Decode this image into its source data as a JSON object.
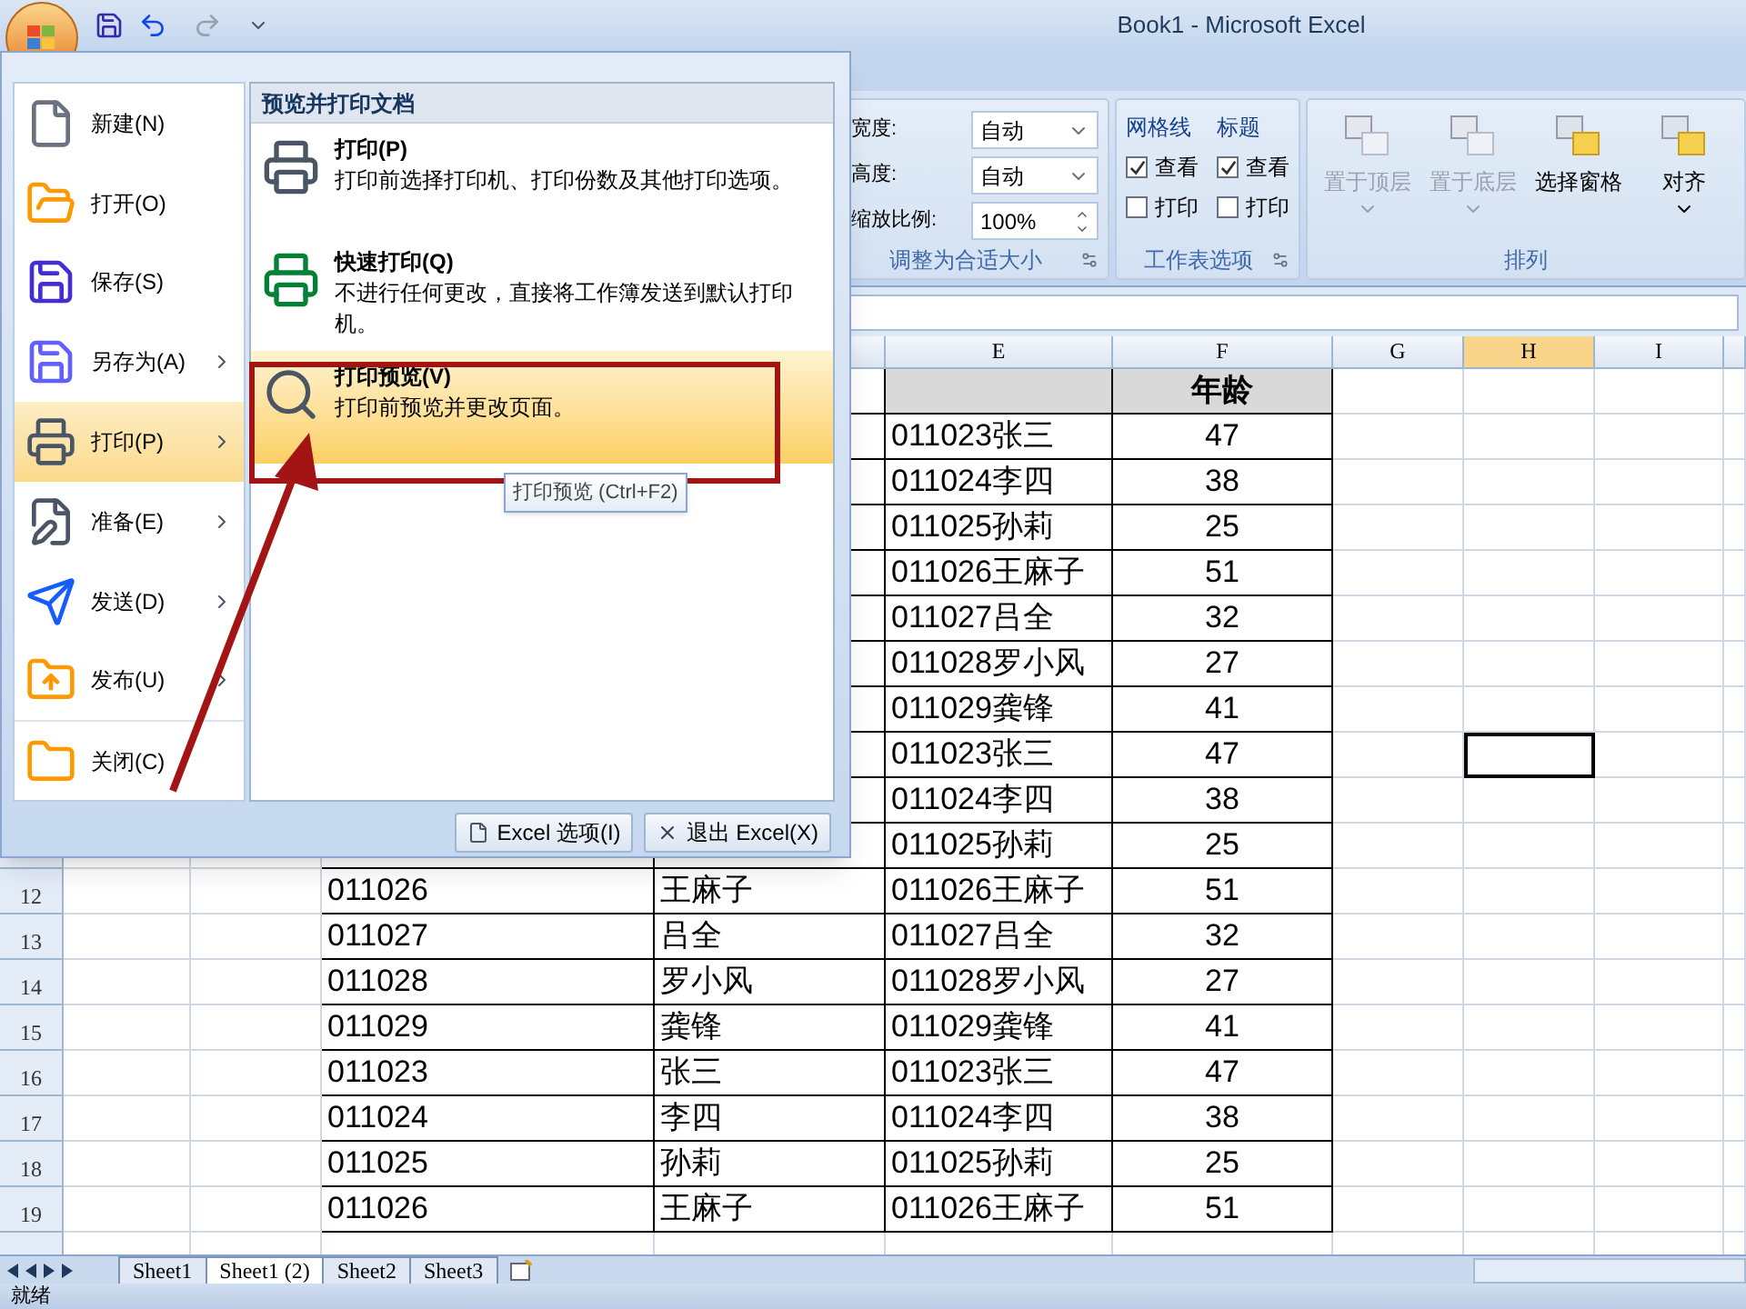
{
  "window": {
    "title": "Book1 - Microsoft Excel"
  },
  "ribbon": {
    "groups": [
      {
        "kind": "scale",
        "label": "调整为合适大小",
        "fields": [
          {
            "kind": "dropdown",
            "label": "宽度:",
            "value": "自动"
          },
          {
            "kind": "dropdown",
            "label": "高度:",
            "value": "自动"
          },
          {
            "kind": "spinner",
            "label": "缩放比例:",
            "value": "100%"
          }
        ]
      },
      {
        "kind": "sheet_options",
        "label": "工作表选项",
        "columns": [
          {
            "title": "网格线",
            "options": [
              {
                "label": "查看",
                "checked": true
              },
              {
                "label": "打印",
                "checked": false
              }
            ]
          },
          {
            "title": "标题",
            "options": [
              {
                "label": "查看",
                "checked": true
              },
              {
                "label": "打印",
                "checked": false
              }
            ]
          }
        ]
      },
      {
        "kind": "arrange",
        "label": "排列",
        "buttons": [
          {
            "label": "置于顶层",
            "disabled": true,
            "has_dropdown": true
          },
          {
            "label": "置于底层",
            "disabled": true,
            "has_dropdown": true
          },
          {
            "label": "选择窗格",
            "disabled": false,
            "has_dropdown": false
          },
          {
            "label": "对齐",
            "disabled": false,
            "has_dropdown": true
          }
        ]
      }
    ]
  },
  "sheet": {
    "columns": [
      {
        "label": "E",
        "selected": false
      },
      {
        "label": "F",
        "selected": false
      },
      {
        "label": "G",
        "selected": false
      },
      {
        "label": "H",
        "selected": true
      },
      {
        "label": "I",
        "selected": false
      }
    ],
    "rows": [
      {
        "kind": "header",
        "selected": false,
        "f": "年龄"
      },
      {
        "kind": "data",
        "selected": false,
        "e": "011023张三",
        "f": "47"
      },
      {
        "kind": "data",
        "selected": false,
        "e": "011024李四",
        "f": "38"
      },
      {
        "kind": "data",
        "selected": false,
        "e": "011025孙莉",
        "f": "25"
      },
      {
        "kind": "data",
        "selected": false,
        "e": "011026王麻子",
        "f": "51"
      },
      {
        "kind": "data",
        "selected": false,
        "e": "011027吕全",
        "f": "32"
      },
      {
        "kind": "data",
        "selected": false,
        "e": "011028罗小风",
        "f": "27"
      },
      {
        "kind": "data",
        "selected": false,
        "e": "011029龚锋",
        "f": "41"
      },
      {
        "kind": "data",
        "selected": true,
        "e": "011023张三",
        "f": "47"
      },
      {
        "kind": "data",
        "selected": false,
        "e": "011024李四",
        "f": "38"
      },
      {
        "kind": "data",
        "selected": false,
        "e": "011025孙莉",
        "f": "25"
      },
      {
        "kind": "data",
        "selected": false,
        "number": "12",
        "c": "011026",
        "d": "王麻子",
        "e": "011026王麻子",
        "f": "51"
      },
      {
        "kind": "data",
        "selected": false,
        "number": "13",
        "c": "011027",
        "d": "吕全",
        "e": "011027吕全",
        "f": "32"
      },
      {
        "kind": "data",
        "selected": false,
        "number": "14",
        "c": "011028",
        "d": "罗小风",
        "e": "011028罗小风",
        "f": "27"
      },
      {
        "kind": "data",
        "selected": false,
        "number": "15",
        "c": "011029",
        "d": "龚锋",
        "e": "011029龚锋",
        "f": "41"
      },
      {
        "kind": "data",
        "selected": false,
        "number": "16",
        "c": "011023",
        "d": "张三",
        "e": "011023张三",
        "f": "47"
      },
      {
        "kind": "data",
        "selected": false,
        "number": "17",
        "c": "011024",
        "d": "李四",
        "e": "011024李四",
        "f": "38"
      },
      {
        "kind": "data",
        "selected": false,
        "number": "18",
        "c": "011025",
        "d": "孙莉",
        "e": "011025孙莉",
        "f": "25"
      },
      {
        "kind": "data",
        "selected": false,
        "number": "19",
        "c": "011026",
        "d": "王麻子",
        "e": "011026王麻子",
        "f": "51"
      }
    ]
  },
  "sheet_tabs": [
    {
      "label": "Sheet1",
      "selected": false
    },
    {
      "label": "Sheet1 (2)",
      "selected": true
    },
    {
      "label": "Sheet2",
      "selected": false
    },
    {
      "label": "Sheet3",
      "selected": false
    }
  ],
  "status_bar": {
    "text": "就绪"
  },
  "office_menu": {
    "items": [
      {
        "label": "新建(N)",
        "has_submenu": false,
        "selected": false
      },
      {
        "label": "打开(O)",
        "has_submenu": false,
        "selected": false
      },
      {
        "label": "保存(S)",
        "has_submenu": false,
        "selected": false
      },
      {
        "label": "另存为(A)",
        "has_submenu": true,
        "selected": false
      },
      {
        "label": "打印(P)",
        "has_submenu": true,
        "selected": true
      },
      {
        "label": "准备(E)",
        "has_submenu": true,
        "selected": false
      },
      {
        "label": "发送(D)",
        "has_submenu": true,
        "selected": false
      },
      {
        "label": "发布(U)",
        "has_submenu": true,
        "selected": false
      },
      {
        "label": "关闭(C)",
        "has_submenu": false,
        "selected": false
      }
    ],
    "panel": {
      "title": "预览并打印文档",
      "items": [
        {
          "title": "打印(P)",
          "description": "打印前选择打印机、打印份数及其他打印选项。",
          "selected": false
        },
        {
          "title": "快速打印(Q)",
          "description": "不进行任何更改，直接将工作簿发送到默认打印机。",
          "selected": false
        },
        {
          "title": "打印预览(V)",
          "description": "打印前预览并更改页面。",
          "selected": true
        }
      ]
    },
    "buttons": [
      "Excel 选项(I)",
      "退出 Excel(X)"
    ],
    "tooltip": "打印预览 (Ctrl+F2)"
  }
}
